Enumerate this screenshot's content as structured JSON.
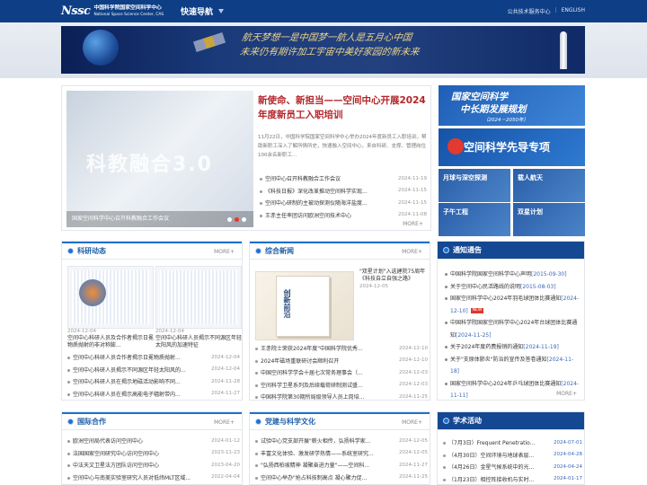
{
  "header": {
    "logo_mark": "Nssc",
    "org_cn": "中国科学院国家空间科学中心",
    "org_en": "National Space Science Center, CAS",
    "quicknav_label": "快速导航",
    "links": [
      "公共技术服务中心",
      "ENGLISH"
    ],
    "link_separator": "|"
  },
  "banner": {
    "slogan_line1": "航天梦想一是中国梦一航人是五月心中国",
    "slogan_line2": "未来仍有期许加工宇宙中美好家园的新未来"
  },
  "hero": {
    "slide_text": "科教融合3.0",
    "slide_caption": "国家空间科学中心召开科教融合工作会议",
    "slide_dots": 3,
    "active_dot": 2,
    "headline": "新使命、新担当——空间中心开展2024年度新员工入职培训",
    "summary": "11月22日，中国科学院国家空间科学中心举办2024年度新员工入职培训，帮助新职工深入了解所情所史，快速融入空间中心，来自科研、支撑、管理岗位100余名新职工...",
    "news": [
      {
        "title": "空间中心召开科教融合工作会议",
        "date": "2024-11-19"
      },
      {
        "title": "《科技日报》深化改革推动空间科学实现...",
        "date": "2024-11-15"
      },
      {
        "title": "空间中心研制的主被动探测仪随海洋盐度...",
        "date": "2024-11-15"
      },
      {
        "title": "王赤主任率团访问欧洲空间技术中心",
        "date": "2024-11-08"
      }
    ],
    "more_label": "MORE+"
  },
  "promos": {
    "plan_line1": "国家空间科学",
    "plan_line2": "中长期发展规划",
    "plan_years": "（2024－2050年）",
    "pioneer": "空间科学先导专项",
    "tiles": [
      "月球与深空探测",
      "载人航天",
      "子午工程",
      "双星计划"
    ]
  },
  "research": {
    "title": "科研动态",
    "more": "MORE+",
    "items": [
      {
        "date": "2024-12-04",
        "title": "空间中心科研人员及合作者揭示日冕物质抛射的非对称膨..."
      },
      {
        "date": "2024-12-04",
        "title": "空间中心科研人员揭示不同源区年轻太阳风的加速特征"
      }
    ],
    "news": [
      {
        "title": "空间中心科研人员合作者揭示日冕物质抛射...",
        "date": "2024-12-04"
      },
      {
        "title": "空间中心科研人员揭示不同源区年轻太阳风的...",
        "date": "2024-12-04"
      },
      {
        "title": "空间中心科研人员在揭示地磁活动影响不同...",
        "date": "2024-11-28"
      },
      {
        "title": "空间中心科研人员在揭示高能电子辐射带内...",
        "date": "2024-11-27"
      }
    ]
  },
  "general": {
    "title": "综合新闻",
    "more": "MORE+",
    "book_title": "创新前沿",
    "feature_title": "\"双星计划\"入选建院75周年《科技自立自强之路》",
    "feature_date": "2024-12-05",
    "news": [
      {
        "title": "王赤院士荣获2024年度\"中国科学院优秀...",
        "date": "2024-12-10"
      },
      {
        "title": "2024年磁场重联研讨会顺利召开",
        "date": "2024-12-10"
      },
      {
        "title": "中国空间科学学会十届七次常务理事会（...",
        "date": "2024-12-03"
      },
      {
        "title": "空间科学卫星系列及后续载荷研制测试盛...",
        "date": "2024-12-03"
      },
      {
        "title": "中国科学院第30期所局级领导人员上岗培...",
        "date": "2024-11-25"
      }
    ]
  },
  "notices": {
    "title": "通知通告",
    "more": "MORE+",
    "new_label": "NEW",
    "items": [
      {
        "text": "中国科学院国家空间科学中心声明",
        "date": "[2015-09-30]",
        "is_new": false
      },
      {
        "text": "关于空间中心民活路线的说明",
        "date": "[2015-08-03]",
        "is_new": false
      },
      {
        "text": "国家空间科学中心2024年羽毛球团体比赛通知",
        "date": "[2024-12-10]",
        "is_new": true
      },
      {
        "text": "中国科学院国家空间科学中心2024年台球团体比赛通知",
        "date": "[2024-11-25]",
        "is_new": false
      },
      {
        "text": "关于2024年度药费报销的通知",
        "date": "[2024-11-19]",
        "is_new": false
      },
      {
        "text": "关于\"支原体肺炎\"防治的宣传及答卷通知",
        "date": "[2024-11-18]",
        "is_new": false
      },
      {
        "text": "国家空间科学中心2024年乒乓球团体比赛通知",
        "date": "[2024-11-11]",
        "is_new": false
      }
    ]
  },
  "intl": {
    "title": "国际合作",
    "more": "MORE+",
    "news": [
      {
        "title": "欧洲空间局代表访问空间中心",
        "date": "2024-01-12"
      },
      {
        "title": "法国国家空间研究中心访问空间中心",
        "date": "2023-11-23"
      },
      {
        "title": "中法天文卫星法方团队访问空间中心",
        "date": "2023-04-20"
      },
      {
        "title": "空间中心与南美实验室研究人员对低纬MLT区域...",
        "date": "2022-04-04"
      }
    ]
  },
  "party": {
    "title": "党建与科学文化",
    "more": "MORE+",
    "news": [
      {
        "title": "试验中心党支部开展\"薪火相传，弘扬科学家...",
        "date": "2024-12-05"
      },
      {
        "title": "丰富文化体验、激发研学热情——系统室研究...",
        "date": "2024-12-05"
      },
      {
        "title": "\"弘扬西柏坡精神 凝聚奋进力量\"——空间科...",
        "date": "2024-11-27"
      },
      {
        "title": "空间中心举办\"抢占科技制高点 凝心聚力促...",
        "date": "2024-11-25"
      }
    ]
  },
  "academic": {
    "title": "学术活动",
    "news": [
      {
        "title": "（7月3日）Frequent Penetratio...",
        "date": "2024-07-01"
      },
      {
        "title": "（4月30日）空间环境与地球表层...",
        "date": "2024-04-28"
      },
      {
        "title": "（4月26日）金星气候系统中的光...",
        "date": "2024-04-24"
      },
      {
        "title": "（1月23日）相控阵接收机与实时...",
        "date": "2024-01-17"
      }
    ]
  }
}
